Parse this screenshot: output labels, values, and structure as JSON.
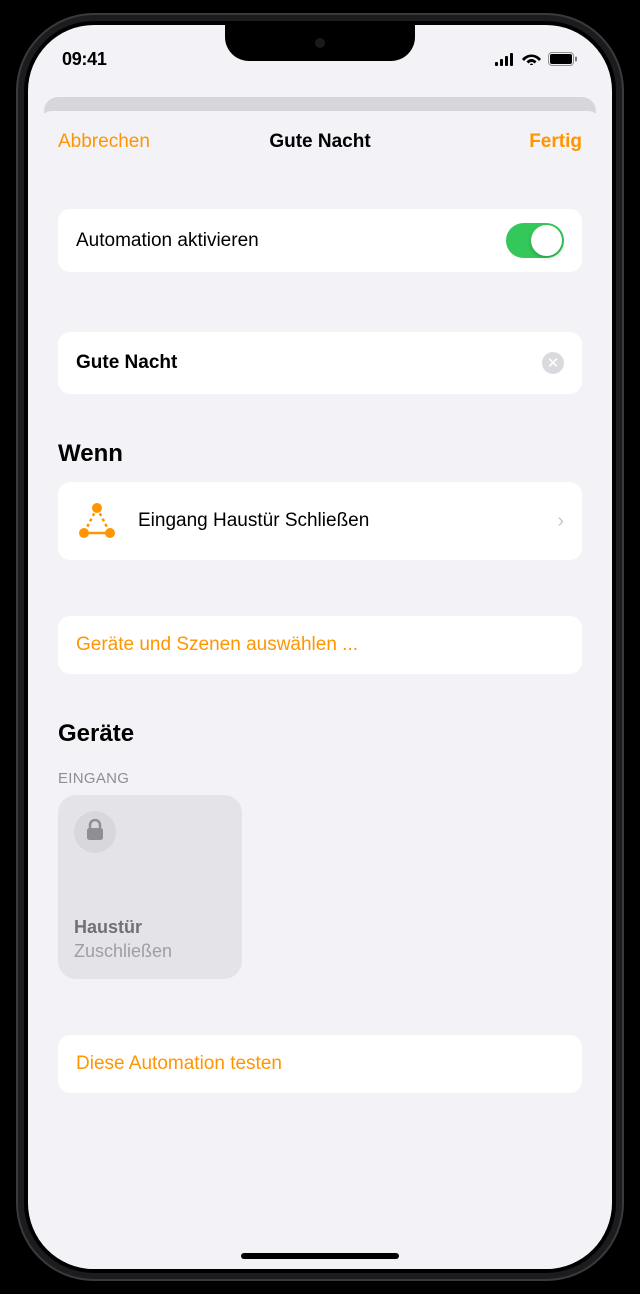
{
  "status": {
    "time": "09:41"
  },
  "nav": {
    "cancel": "Abbrechen",
    "title": "Gute Nacht",
    "done": "Fertig"
  },
  "automation": {
    "enable_label": "Automation aktivieren",
    "name": "Gute Nacht"
  },
  "sections": {
    "when": "Wenn",
    "devices": "Geräte"
  },
  "trigger": {
    "label": "Eingang Haustür Schließen"
  },
  "actions": {
    "select_devices": "Geräte und Szenen auswählen ...",
    "test": "Diese Automation testen"
  },
  "device_group": {
    "label": "EINGANG"
  },
  "device": {
    "name": "Haustür",
    "action": "Zuschließen"
  },
  "colors": {
    "accent": "#ff9500",
    "toggle_on": "#34c759"
  }
}
